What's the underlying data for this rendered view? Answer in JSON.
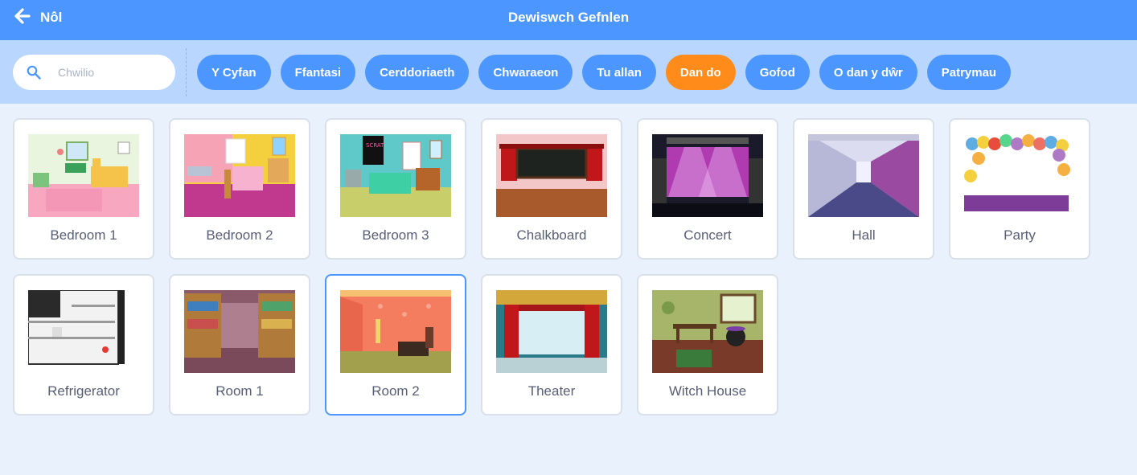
{
  "header": {
    "back_label": "Nôl",
    "title": "Dewiswch Gefnlen"
  },
  "search": {
    "placeholder": "Chwilio",
    "value": ""
  },
  "tags": [
    {
      "label": "Y Cyfan",
      "active": false
    },
    {
      "label": "Ffantasi",
      "active": false
    },
    {
      "label": "Cerddoriaeth",
      "active": false
    },
    {
      "label": "Chwaraeon",
      "active": false
    },
    {
      "label": "Tu allan",
      "active": false
    },
    {
      "label": "Dan do",
      "active": true
    },
    {
      "label": "Gofod",
      "active": false
    },
    {
      "label": "O dan y dŵr",
      "active": false
    },
    {
      "label": "Patrymau",
      "active": false
    }
  ],
  "backdrops": [
    {
      "name": "Bedroom 1",
      "selected": false
    },
    {
      "name": "Bedroom 2",
      "selected": false
    },
    {
      "name": "Bedroom 3",
      "selected": false
    },
    {
      "name": "Chalkboard",
      "selected": false
    },
    {
      "name": "Concert",
      "selected": false
    },
    {
      "name": "Hall",
      "selected": false
    },
    {
      "name": "Party",
      "selected": false
    },
    {
      "name": "Refrigerator",
      "selected": false
    },
    {
      "name": "Room 1",
      "selected": false
    },
    {
      "name": "Room 2",
      "selected": true
    },
    {
      "name": "Theater",
      "selected": false
    },
    {
      "name": "Witch House",
      "selected": false
    }
  ],
  "colors": {
    "header_blue": "#4c97ff",
    "filter_bar": "#b9d6ff",
    "active_tag": "#ff8c1a",
    "page_bg": "#e9f1fc"
  }
}
